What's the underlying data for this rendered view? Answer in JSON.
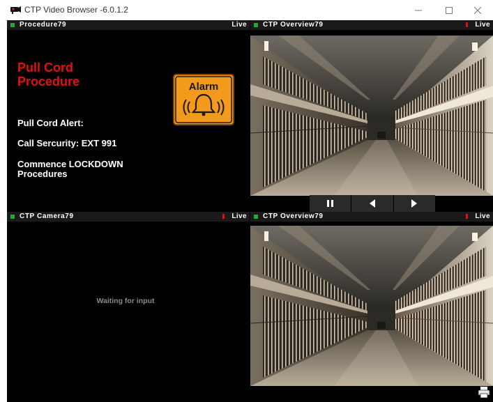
{
  "window": {
    "title": "CTP Video Browser -6.0.1.2"
  },
  "panels": {
    "top_left": {
      "name": "Procedure79",
      "status": "Live",
      "indicator_color": "#22aa33",
      "status_color": "#22aa33"
    },
    "top_right": {
      "name": "CTP Overview79",
      "status": "Live",
      "indicator_color": "#22aa33",
      "status_color": "#dd1111"
    },
    "bottom_left": {
      "name": "CTP Camera79",
      "status": "Live",
      "indicator_color": "#22aa33",
      "status_color": "#dd1111"
    },
    "bottom_right": {
      "name": "CTP Overview79",
      "status": "Live",
      "indicator_color": "#22aa33",
      "status_color": "#dd1111"
    }
  },
  "procedure": {
    "title_line1": "Pull Cord",
    "title_line2": "Procedure",
    "alarm_label": "Alarm",
    "line1": "Pull Cord Alert:",
    "line2": "Call Sercurity: EXT 991",
    "line3a": "Commence LOCKDOWN",
    "line3b": "Procedures"
  },
  "camera": {
    "waiting_text": "Waiting for input"
  },
  "controls": {
    "pause_icon": "pause-icon",
    "prev_icon": "previous-icon",
    "next_icon": "next-icon"
  },
  "colors": {
    "accent_red": "#e21111",
    "alarm_orange": "#f39a1c",
    "background": "#000000"
  }
}
